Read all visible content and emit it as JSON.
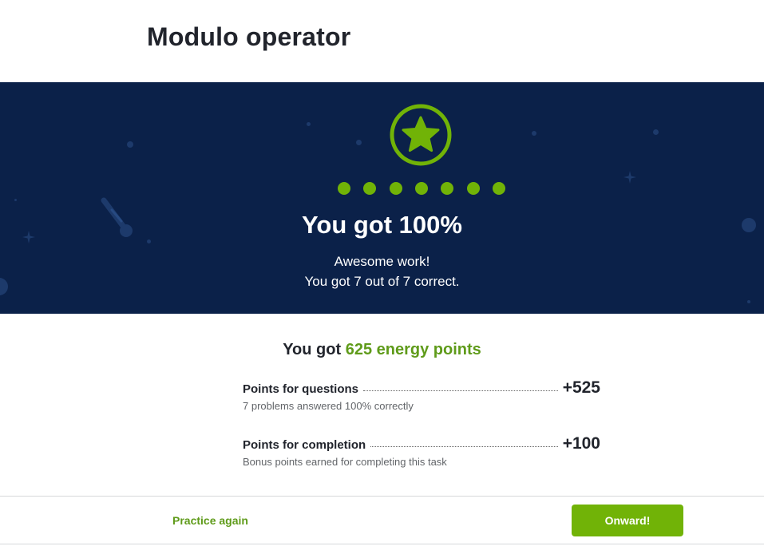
{
  "page": {
    "title": "Modulo operator"
  },
  "result": {
    "headline": "You got 100%",
    "message": "Awesome work!",
    "detail": "You got 7 out of 7 correct.",
    "questions_correct": 7,
    "questions_total": 7
  },
  "energy": {
    "prefix": "You got",
    "points_text": "625 energy points"
  },
  "breakdown": [
    {
      "label": "Points for questions",
      "value": "+525",
      "description": "7 problems answered 100% correctly"
    },
    {
      "label": "Points for completion",
      "value": "+100",
      "description": "Bonus points earned for completing this task"
    }
  ],
  "actions": {
    "practice_again": "Practice again",
    "onward": "Onward!"
  },
  "colors": {
    "banner": "#0b2149",
    "accent_green": "#71b307",
    "text_green": "#5f9b1a"
  },
  "icons": {
    "badge": "star-badge-icon"
  }
}
